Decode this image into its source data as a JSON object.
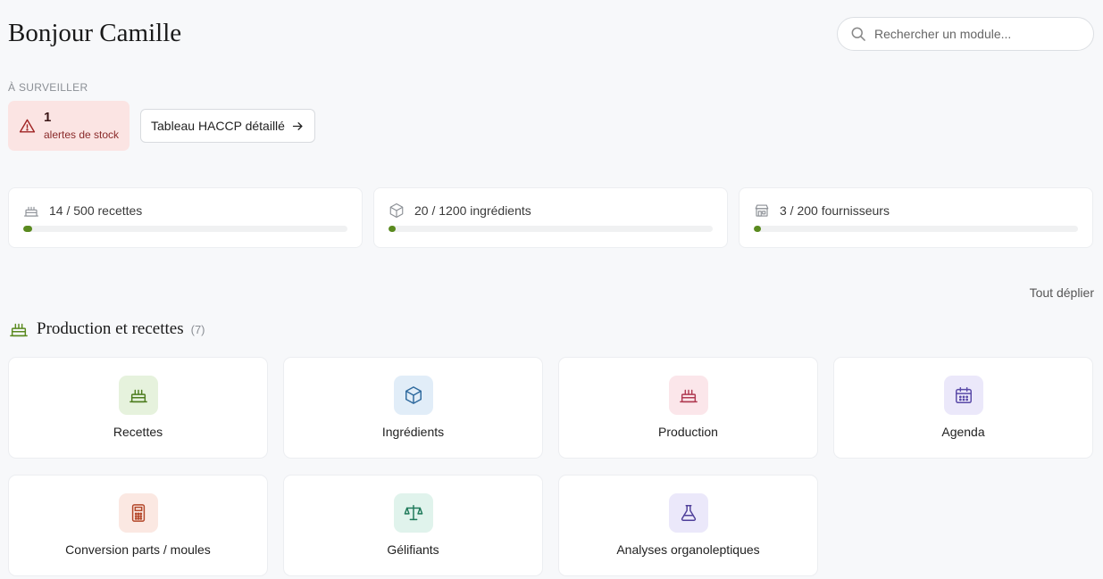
{
  "header": {
    "greeting": "Bonjour Camille",
    "search_placeholder": "Rechercher un module..."
  },
  "watch": {
    "label": "À SURVEILLER",
    "alert_count": "1",
    "alert_label": "alertes de stock",
    "haccp_label": "Tableau HACCP détaillé"
  },
  "stats": [
    {
      "text": "14 / 500 recettes",
      "icon": "cake-icon",
      "progress": 0.028
    },
    {
      "text": "20 / 1200 ingrédients",
      "icon": "box-icon",
      "progress": 0.017
    },
    {
      "text": "3 / 200 fournisseurs",
      "icon": "store-icon",
      "progress": 0.015
    }
  ],
  "expand_all": "Tout déplier",
  "section": {
    "title": "Production et recettes",
    "count": "(7)",
    "icon": "cake-icon",
    "accent": "#5a8a1f",
    "modules": [
      {
        "label": "Recettes",
        "icon": "cake-icon",
        "bg": "#e6f2dd",
        "fg": "#4e7d1f"
      },
      {
        "label": "Ingrédients",
        "icon": "box-icon",
        "bg": "#e1edf8",
        "fg": "#2f6a9e"
      },
      {
        "label": "Production",
        "icon": "cake-icon",
        "bg": "#fbe6ea",
        "fg": "#b03a52"
      },
      {
        "label": "Agenda",
        "icon": "calendar-icon",
        "bg": "#ebe8fa",
        "fg": "#5a4aa8"
      },
      {
        "label": "Conversion parts / moules",
        "icon": "calculator-icon",
        "bg": "#fbe8e2",
        "fg": "#b4472a"
      },
      {
        "label": "Gélifiants",
        "icon": "scale-icon",
        "bg": "#e0f3ec",
        "fg": "#1f7a5a"
      },
      {
        "label": "Analyses organoleptiques",
        "icon": "flask-icon",
        "bg": "#ebe8fa",
        "fg": "#4f3f9a"
      }
    ]
  },
  "colors": {
    "alert_bg": "#fbe4e3",
    "alert_icon": "#a02424",
    "progress": "#5a8a1f"
  }
}
